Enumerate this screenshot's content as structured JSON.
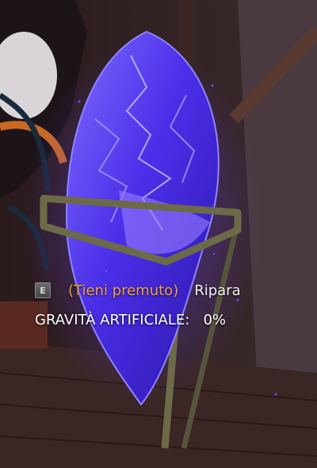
{
  "interaction_prompt": {
    "key_icon": "keyboard-key-e",
    "key_label": "E",
    "hold_label": "(Tieni premuto)",
    "action_label": "Ripara"
  },
  "status": {
    "label": "GRAVITÀ ARTIFICIALE:",
    "value": "0%"
  },
  "colors": {
    "hold_text": "#f0a23a",
    "action_text": "#f2f2f2",
    "crystal_glow": "#6a3cff"
  }
}
